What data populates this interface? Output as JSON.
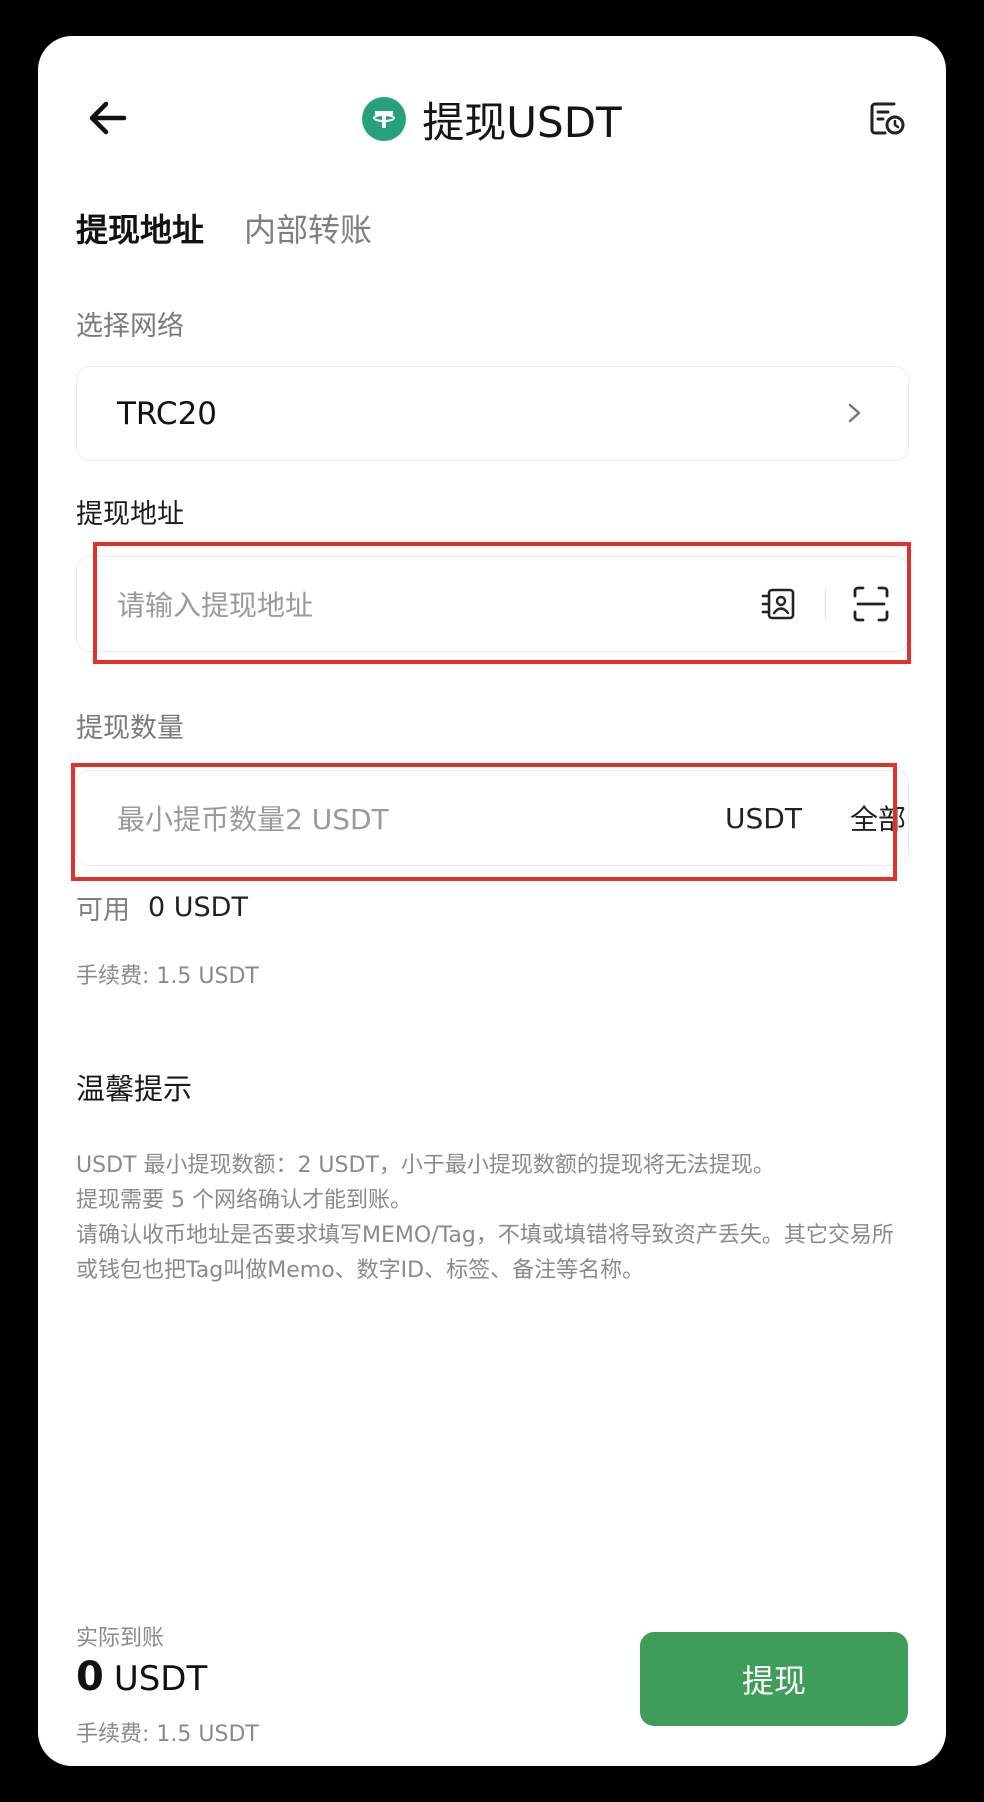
{
  "header": {
    "title": "提现USDT",
    "back_icon": "arrow-left-icon",
    "coin_icon": "tether-icon",
    "history_icon": "history-record-icon"
  },
  "tabs": [
    {
      "label": "提现地址",
      "active": true
    },
    {
      "label": "内部转账",
      "active": false
    }
  ],
  "network": {
    "label": "选择网络",
    "value": "TRC20"
  },
  "address": {
    "label": "提现地址",
    "placeholder": "请输入提现地址",
    "address_book_icon": "address-book-icon",
    "scan_icon": "scan-icon"
  },
  "amount": {
    "label": "提现数量",
    "placeholder": "最小提币数量2 USDT",
    "unit": "USDT",
    "all_label": "全部"
  },
  "available": {
    "label": "可用",
    "value": "0 USDT"
  },
  "fee": "手续费: 1.5 USDT",
  "tips": {
    "title": "温馨提示",
    "lines": [
      "USDT 最小提现数额：2 USDT，小于最小提现数额的提现将无法提现。",
      "提现需要 5 个网络确认才能到账。",
      "请确认收币地址是否要求填写MEMO/Tag，不填或填错将导致资产丢失。其它交易所或钱包也把Tag叫做Memo、数字ID、标签、备注等名称。"
    ]
  },
  "bottom": {
    "received_label": "实际到账",
    "amount_value": "0",
    "amount_unit": "USDT",
    "fee": "手续费: 1.5 USDT",
    "submit_label": "提现"
  },
  "colors": {
    "accent": "#3f9d5a",
    "tether": "#26a17b",
    "highlight": "#e0322b"
  }
}
